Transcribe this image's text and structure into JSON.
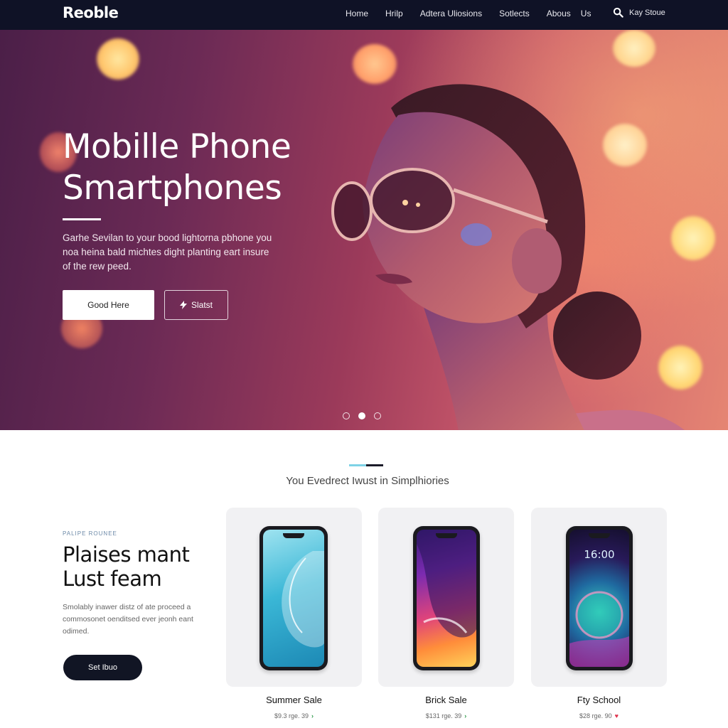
{
  "nav": {
    "logo": "Reoble",
    "links": [
      "Home",
      "Hrilp",
      "Adtera Uliosions",
      "Sotlects",
      "Abous",
      "Us"
    ],
    "search_label": "Kay Stoue",
    "search_icon": "search-icon"
  },
  "hero": {
    "title_line1": "Mobille Phone",
    "title_line2": "Smartphones",
    "description": "Garhe Sevilan to your bood lightorna pbhone you noa heina bald michtes dight planting eart insure of the rew peed.",
    "primary_button": "Good Here",
    "secondary_button": "Slatst",
    "secondary_icon": "bolt-icon",
    "carousel_active_index": 1,
    "carousel_count": 3
  },
  "section": {
    "heading": "You Evedrect Iwust in Simplhiories"
  },
  "promo": {
    "kicker": "PALIPE ROUNEE",
    "title_line1": "Plaises mant",
    "title_line2": "Lust feam",
    "description": "Smolably inawer distz of ate proceed a commosonet oenditsed ever jeonh eant odimed.",
    "button": "Set Ibuo"
  },
  "products": [
    {
      "name": "Summer Sale",
      "price": "$9.3 rge. 39",
      "icon": "arrow-right-icon"
    },
    {
      "name": "Brick Sale",
      "price": "$131 rge. 39",
      "icon": "arrow-right-icon"
    },
    {
      "name": "Fty School",
      "price": "$28 rge. 90",
      "icon": "heart-icon",
      "clock": "16:00"
    }
  ],
  "colors": {
    "nav_bg": "#0f1226",
    "hero_accent": "#c8586a",
    "promo_button": "#111524",
    "price_arrow": "#2e9a4a",
    "price_heart": "#e0334d"
  }
}
